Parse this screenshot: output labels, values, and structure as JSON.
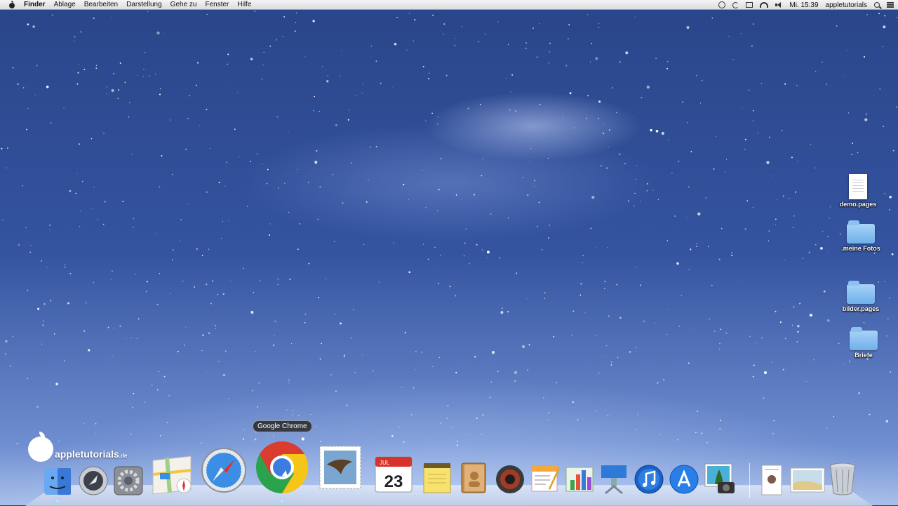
{
  "menubar": {
    "app_name": "Finder",
    "items": [
      "Ablage",
      "Bearbeiten",
      "Darstellung",
      "Gehe zu",
      "Fenster",
      "Hilfe"
    ],
    "clock": "Mi. 15:39",
    "user": "appletutorials"
  },
  "desktop": {
    "icons": [
      {
        "label": "demo.pages",
        "type": "document"
      },
      {
        "label": ".meine Fotos",
        "type": "folder"
      },
      {
        "label": "bilder.pages",
        "type": "folder"
      },
      {
        "label": "Briefe",
        "type": "folder"
      }
    ]
  },
  "brand": {
    "name": "appletutorials",
    "suffix": ".de"
  },
  "dock": {
    "tooltip": "Google Chrome",
    "calendar": {
      "month": "JUL",
      "day": "23"
    },
    "apps": [
      {
        "name": "finder-icon"
      },
      {
        "name": "launchpad-icon"
      },
      {
        "name": "system-preferences-icon"
      },
      {
        "name": "maps-icon"
      },
      {
        "name": "safari-icon"
      },
      {
        "name": "google-chrome-icon"
      },
      {
        "name": "mail-icon"
      },
      {
        "name": "calendar-icon"
      },
      {
        "name": "notes-icon"
      },
      {
        "name": "contacts-icon"
      },
      {
        "name": "photo-booth-icon"
      },
      {
        "name": "pages-icon"
      },
      {
        "name": "numbers-icon"
      },
      {
        "name": "keynote-icon"
      },
      {
        "name": "itunes-icon"
      },
      {
        "name": "app-store-icon"
      },
      {
        "name": "iphoto-icon"
      },
      {
        "name": "documents-stack-icon"
      },
      {
        "name": "downloads-stack-icon"
      },
      {
        "name": "trash-icon"
      }
    ]
  }
}
